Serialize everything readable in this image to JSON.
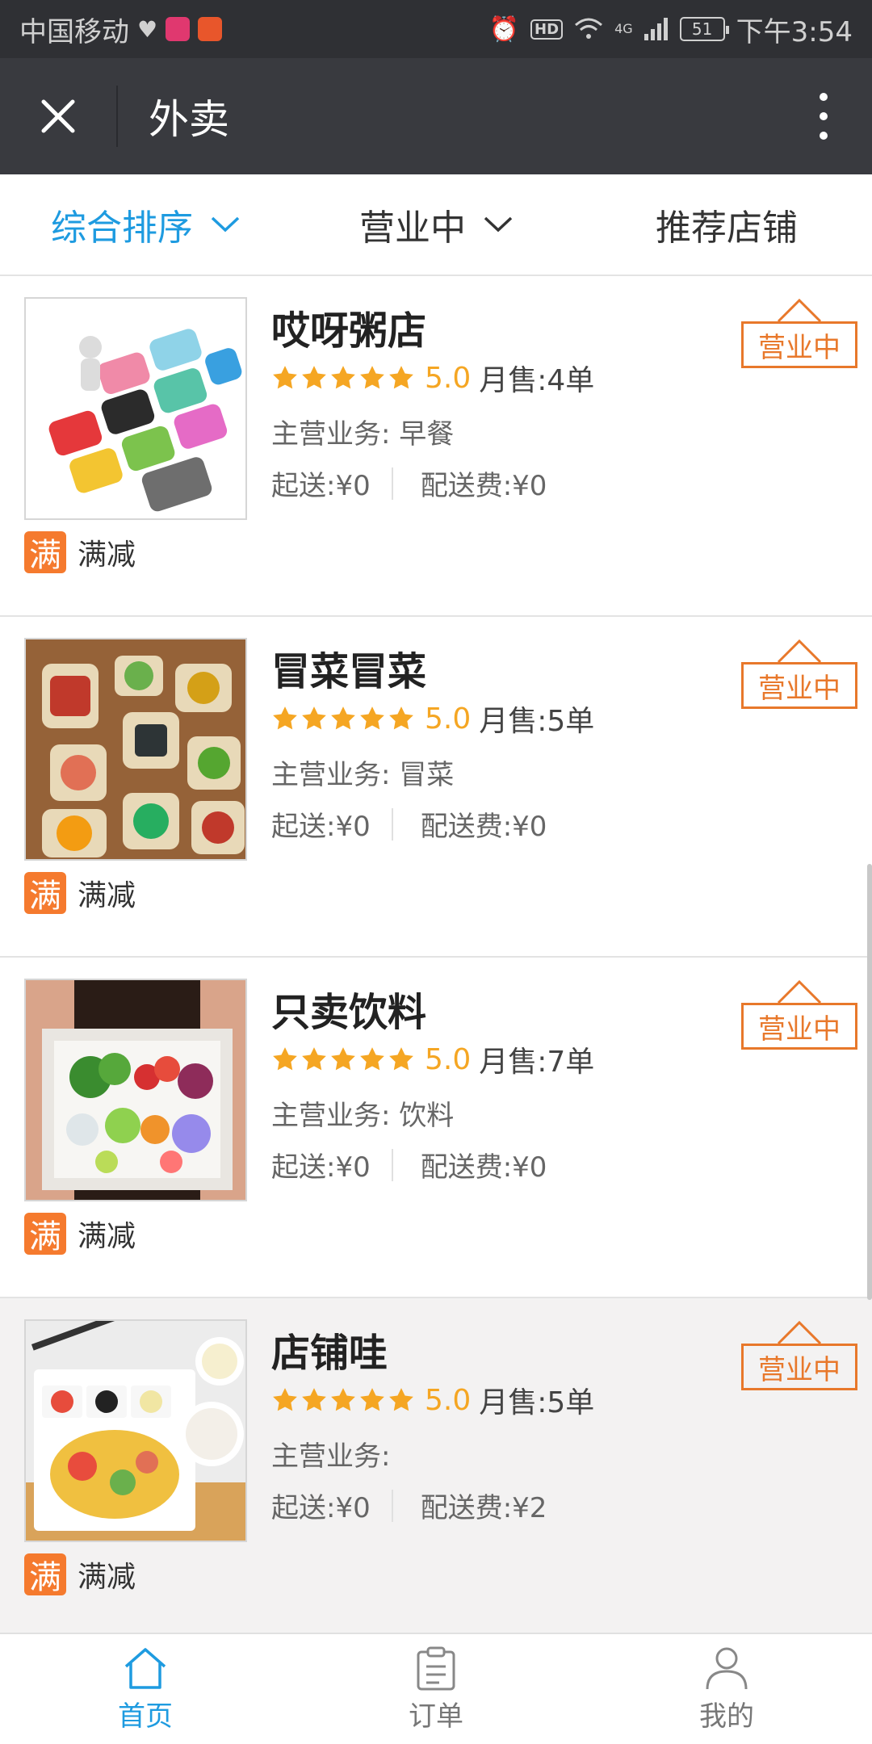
{
  "status_bar": {
    "carrier": "中国移动",
    "hd": "HD",
    "network": "4G",
    "battery": "51",
    "time": "下午3:54"
  },
  "title_bar": {
    "title": "外卖"
  },
  "filters": [
    {
      "label": "综合排序",
      "active": true
    },
    {
      "label": "营业中",
      "active": false
    },
    {
      "label": "推荐店铺",
      "active": false
    }
  ],
  "shops": [
    {
      "name": "哎呀粥店",
      "rating": "5.0",
      "sales": "月售:4单",
      "business": "主营业务:  早餐",
      "min_order": "起送:¥0",
      "delivery_fee": "配送费:¥0",
      "promo_badge": "满",
      "promo_text": "满减",
      "status": "营业中"
    },
    {
      "name": "冒菜冒菜",
      "rating": "5.0",
      "sales": "月售:5单",
      "business": "主营业务:  冒菜",
      "min_order": "起送:¥0",
      "delivery_fee": "配送费:¥0",
      "promo_badge": "满",
      "promo_text": "满减",
      "status": "营业中"
    },
    {
      "name": "只卖饮料",
      "rating": "5.0",
      "sales": "月售:7单",
      "business": "主营业务:  饮料",
      "min_order": "起送:¥0",
      "delivery_fee": "配送费:¥0",
      "promo_badge": "满",
      "promo_text": "满减",
      "status": "营业中"
    },
    {
      "name": "店铺哇",
      "rating": "5.0",
      "sales": "月售:5单",
      "business": "主营业务:",
      "min_order": "起送:¥0",
      "delivery_fee": "配送费:¥2",
      "promo_badge": "满",
      "promo_text": "满减",
      "status": "营业中"
    }
  ],
  "bottom_nav": [
    {
      "label": "首页",
      "icon": "home-icon",
      "active": true
    },
    {
      "label": "订单",
      "icon": "order-clipboard-icon",
      "active": false
    },
    {
      "label": "我的",
      "icon": "profile-icon",
      "active": false
    }
  ],
  "colors": {
    "accent": "#1e9be0",
    "star": "#f5a623",
    "open_sign": "#e8782b",
    "promo": "#f57a2e",
    "title_bar": "#393a3f"
  }
}
